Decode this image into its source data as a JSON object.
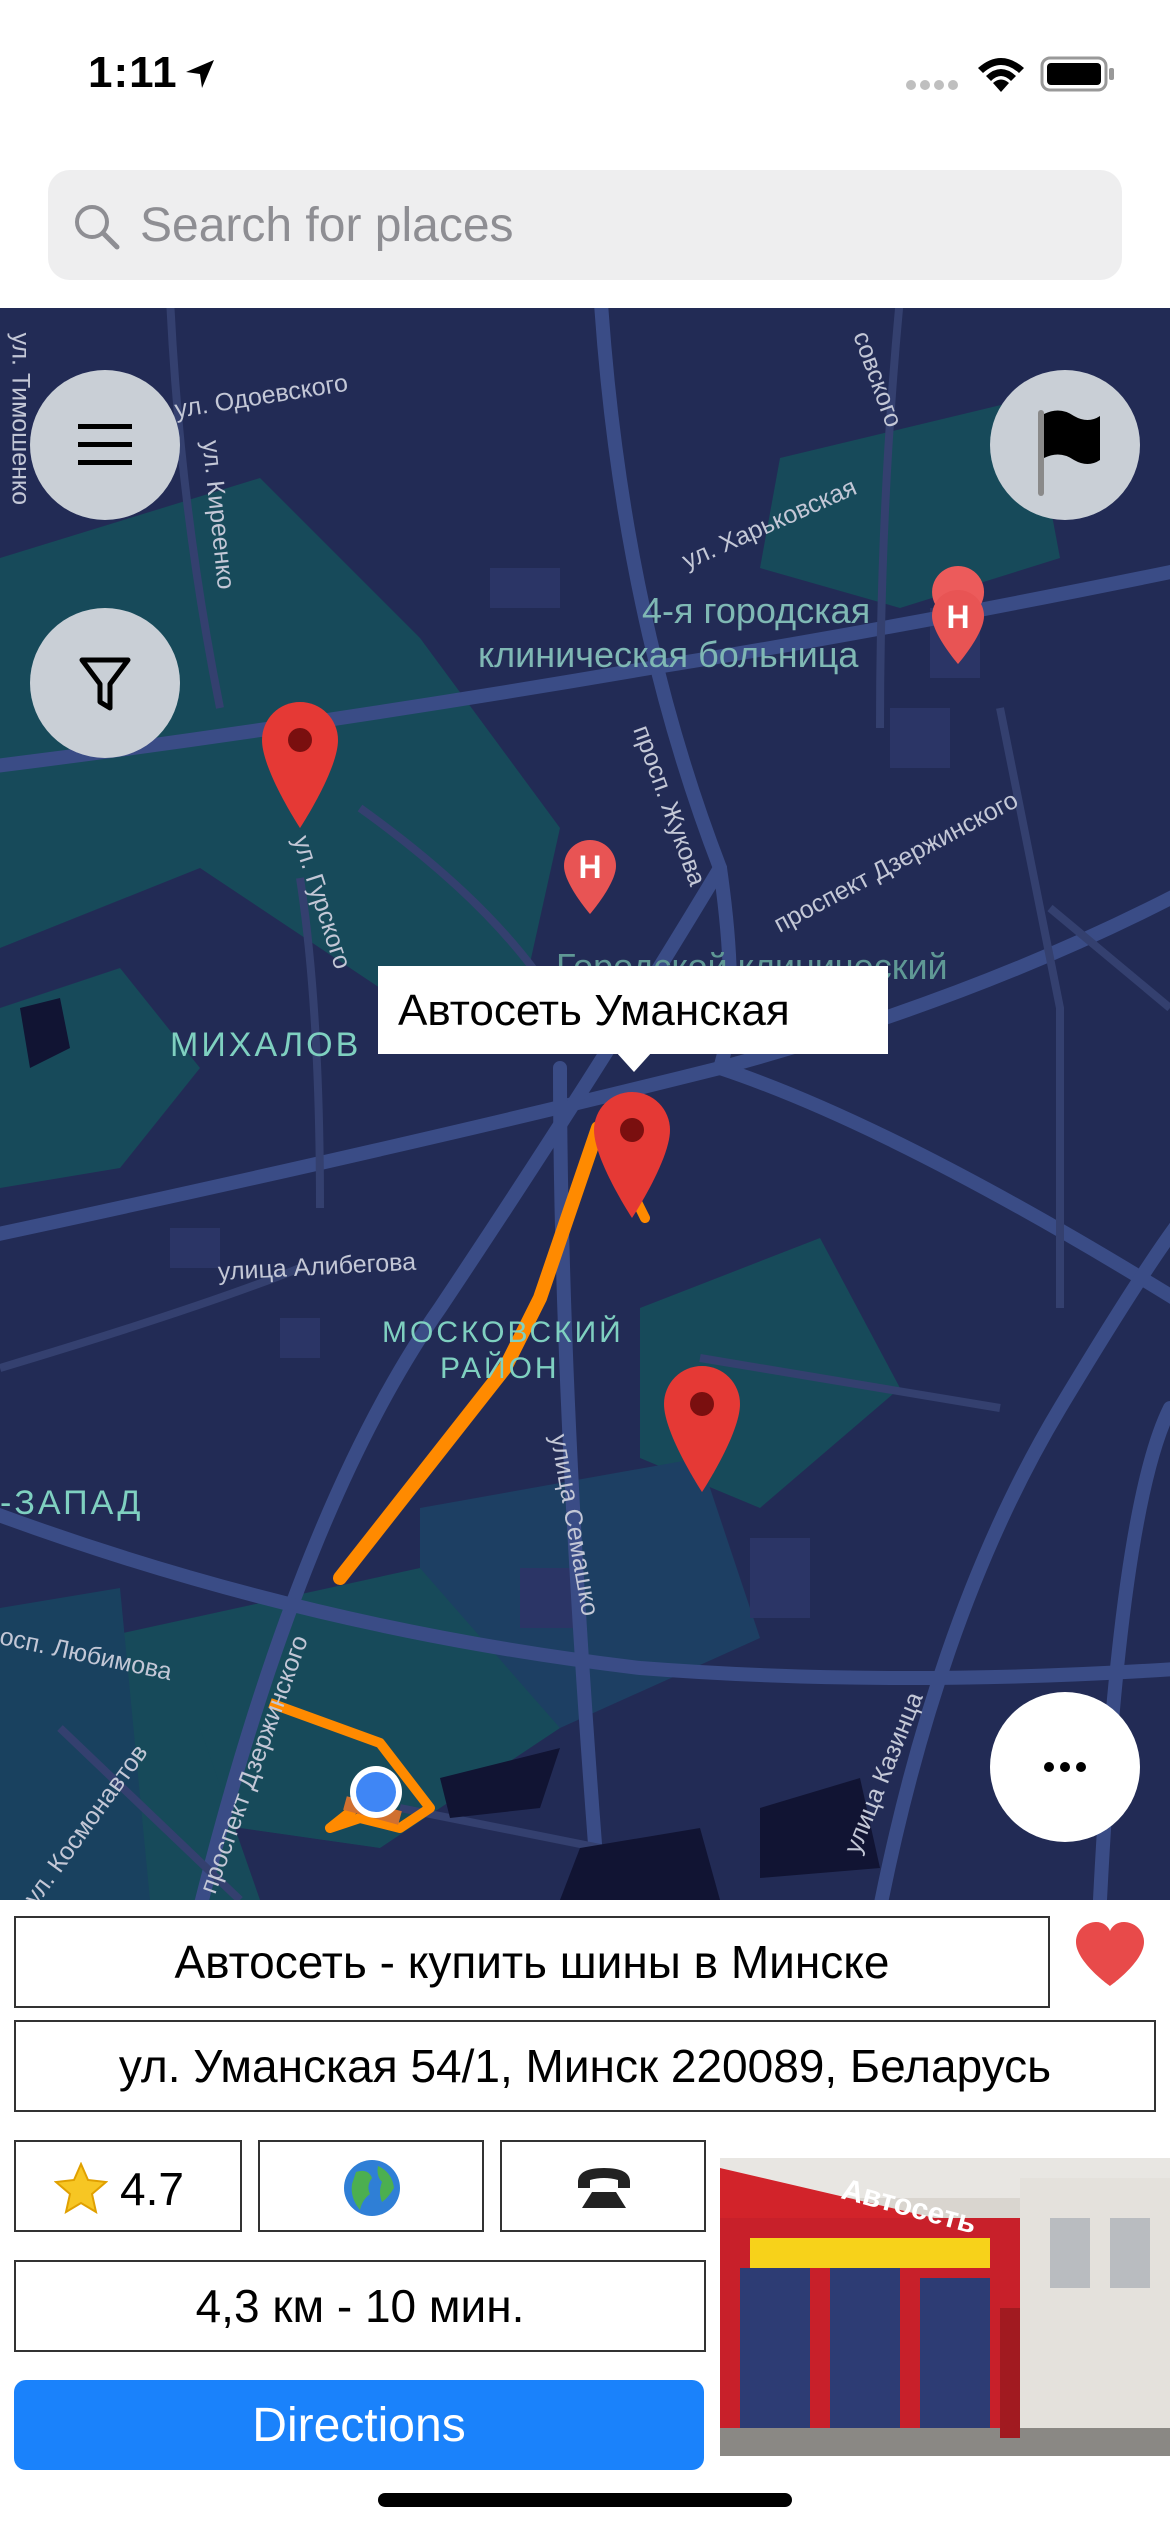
{
  "status_bar": {
    "time": "1:11"
  },
  "search": {
    "placeholder": "Search for places"
  },
  "map": {
    "labels": {
      "hospital_name_line1": "4-я городская",
      "hospital_name_line2": "клиническая больница",
      "district_mikhalovo": "МИХАЛОВ",
      "district_moskovsky_line1": "МОСКОВСКИЙ",
      "district_moskovsky_line2": "РАЙОН",
      "district_zapad": "-ЗАПАД",
      "city_clinical": "Городской клинический"
    },
    "streets": {
      "odoevskogo": "ул. Одоевского",
      "kirenko": "ул. Киреенко",
      "timoshenko": "ул. Тимошенко",
      "kharkovskaya": "ул. Харьковская",
      "zhukova": "просп. Жукова",
      "dzerzhinskogo_ne": "проспект Дзержинского",
      "gurskogo": "ул. Гурского",
      "alibegova": "улица Алибегова",
      "semashko": "улица Семашко",
      "dzerzhinskogo_sw": "проспект Дзержинского",
      "lyubimova": "осп. Любимова",
      "kosmonavtov": "ул. Космонавтов",
      "kazintsa": "улица Казинца",
      "sovskogo": "совского"
    },
    "callout": "Автосеть Уманская",
    "colors": {
      "background": "#222b55",
      "route": "#ff8a00",
      "pin": "#e53935",
      "user_location": "#3f86f5"
    }
  },
  "buttons": {
    "menu_icon": "hamburger-icon",
    "filter_icon": "filter-icon",
    "flag_icon": "flag-icon",
    "more_icon": "more-icon"
  },
  "place": {
    "name": "Автосеть - купить шины в Минске",
    "address": "ул. Уманская 54/1, Минск 220089, Беларусь",
    "rating": "4.7",
    "distance": "4,3 км - 10 мин.",
    "directions_label": "Directions",
    "photo_sign": "Автосеть"
  }
}
